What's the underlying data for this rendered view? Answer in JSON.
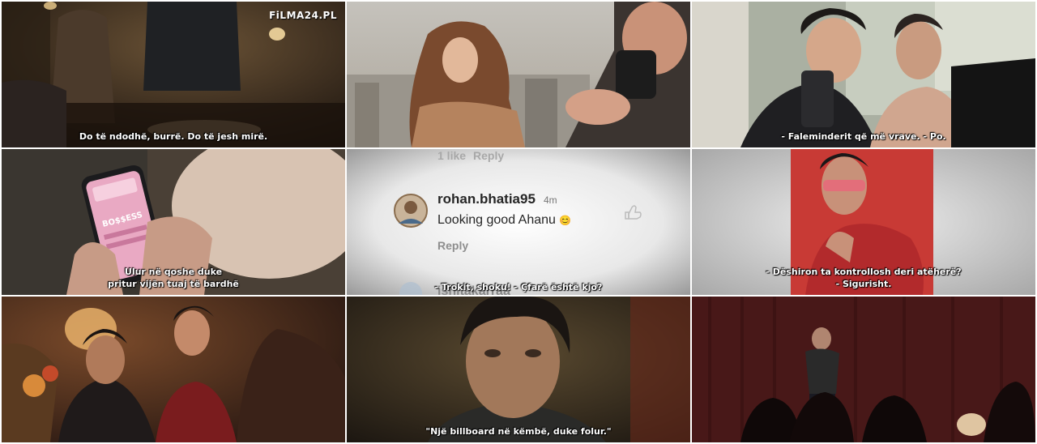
{
  "watermark": "FiLMA24.PL",
  "frames": [
    {
      "id": "frame-1",
      "subtitle_lines": [
        "Do të ndodhë, burrë. Do të jesh mirë."
      ]
    },
    {
      "id": "frame-2",
      "subtitle_lines": []
    },
    {
      "id": "frame-3",
      "subtitle_lines": [
        "- Faleminderit që më vrave. - Po."
      ]
    },
    {
      "id": "frame-4",
      "subtitle_lines": [
        "Ulur në qoshe duke",
        "pritur vijën tuaj të bardhë"
      ]
    },
    {
      "id": "frame-5",
      "subtitle_lines": [
        "- Trokit, shoku! - Çfarë është kjo?"
      ]
    },
    {
      "id": "frame-6",
      "subtitle_lines": [
        "- Dëshiron ta kontrollosh deri atëherë?",
        "- Sigurisht."
      ]
    },
    {
      "id": "frame-7",
      "subtitle_lines": []
    },
    {
      "id": "frame-8",
      "subtitle_lines": [
        "\"Një billboard në këmbë, duke folur.\""
      ]
    },
    {
      "id": "frame-9",
      "subtitle_lines": []
    }
  ],
  "phone_screen_text": "BO$$ESS",
  "instagram": {
    "likes_text": "1 like",
    "reply_top": "Reply",
    "username": "rohan.bhatia95",
    "time": "4m",
    "comment": "Looking good Ahanu",
    "comment_emoji": "😊",
    "reply": "Reply",
    "next_username": "ishitakarraa"
  }
}
